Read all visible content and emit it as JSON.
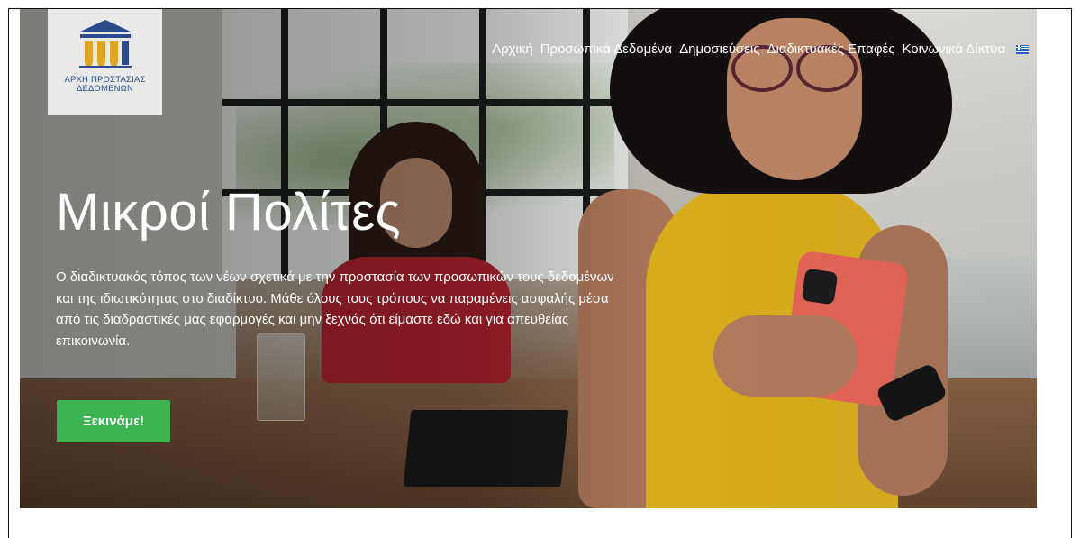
{
  "logo": {
    "line1": "ΑΡΧΗ ΠΡΟΣΤΑΣΙΑΣ",
    "line2": "ΔΕΔΟΜΕΝΩΝ",
    "icon": "building-columns-logo"
  },
  "nav": {
    "items": [
      {
        "label": "Αρχική"
      },
      {
        "label": "Προσωπικά Δεδομένα"
      },
      {
        "label": "Δημοσιεύσεις"
      },
      {
        "label": "Διαδικτυακές Επαφές"
      },
      {
        "label": "Κοινωνικά Δίκτυα"
      }
    ],
    "language_icon": "greek-flag-icon"
  },
  "hero": {
    "title": "Μικροί Πολίτες",
    "description": "Ο διαδικτυακός τόπος των νέων σχετικά με την προστασία των προσωπικών τους δεδομένων και της ιδιωτικότητας στο διαδίκτυο. Μάθε όλους τους τρόπους να παραμένεις ασφαλής μέσα από τις διαδραστικές μας εφαρμογές και μην ξεχνάς ότι είμαστε εδώ και για απευθείας επικοινωνία.",
    "cta_label": "Ξεκινάμε!"
  },
  "colors": {
    "cta_background": "#3db352",
    "logo_blue": "#2b4a8a",
    "logo_gold": "#e0a623"
  }
}
